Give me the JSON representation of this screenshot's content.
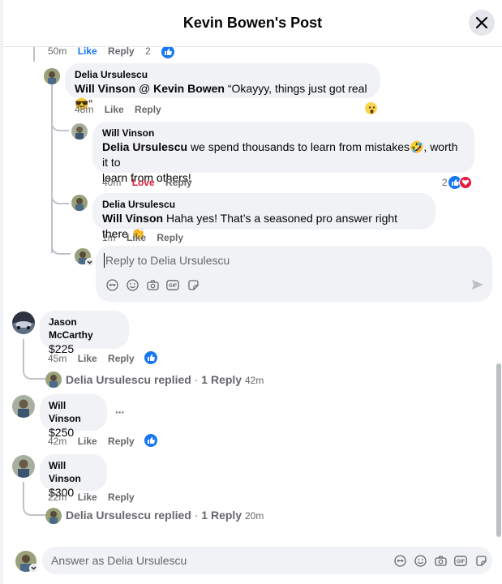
{
  "header": {
    "title": "Kevin Bowen's Post"
  },
  "top_comment_meta": {
    "time": "50m",
    "like": "Like",
    "reply": "Reply",
    "count": "2"
  },
  "c1": {
    "name": "Delia Ursulescu",
    "mention1": "Will Vinson",
    "sep": " @ ",
    "mention2": "Kevin Bowen",
    "body": " “Okayyy, things just got real 😎”",
    "time": "48m",
    "like": "Like",
    "reply": "Reply"
  },
  "c2": {
    "name": "Will Vinson",
    "mention": "Delia Ursulescu",
    "body1": " we spend thousands to learn from mistakes🤣, worth it to",
    "body2": "learn from others!",
    "time": "40m",
    "love": "Love",
    "reply": "Reply",
    "count": "2"
  },
  "c3": {
    "name": "Delia Ursulescu",
    "mention": "Will Vinson",
    "body": " Haha yes! That’s a seasoned pro answer right there 👏",
    "time": "1m",
    "like": "Like",
    "reply": "Reply"
  },
  "reply_input": {
    "placeholder": "Reply to Delia Ursulescu"
  },
  "c4": {
    "name": "Jason McCarthy",
    "body": "$225",
    "time": "45m",
    "like": "Like",
    "reply": "Reply",
    "replied_name": "Delia Ursulescu replied",
    "replied_dot": " · ",
    "replied_count": "1 Reply",
    "replied_time": "42m"
  },
  "c5": {
    "name": "Will Vinson",
    "body": "$250",
    "time": "42m",
    "like": "Like",
    "reply": "Reply",
    "more": "···"
  },
  "c6": {
    "name": "Will Vinson",
    "body": "$300",
    "time": "22m",
    "like": "Like",
    "reply": "Reply",
    "replied_name": "Delia Ursulescu replied",
    "replied_dot": " · ",
    "replied_count": "1 Reply",
    "replied_time": "20m"
  },
  "footer": {
    "placeholder": "Answer as Delia Ursulescu"
  },
  "colors": {
    "accent": "#1877f2",
    "love": "#e41e3f",
    "bubble": "#f0f2f5",
    "muted": "#65676b"
  },
  "icons": [
    "close-icon",
    "like-reaction-icon",
    "love-reaction-icon",
    "wow-reaction-icon",
    "avatar-sticker-icon",
    "emoji-icon",
    "camera-icon",
    "gif-icon",
    "sticker-icon",
    "send-icon"
  ]
}
